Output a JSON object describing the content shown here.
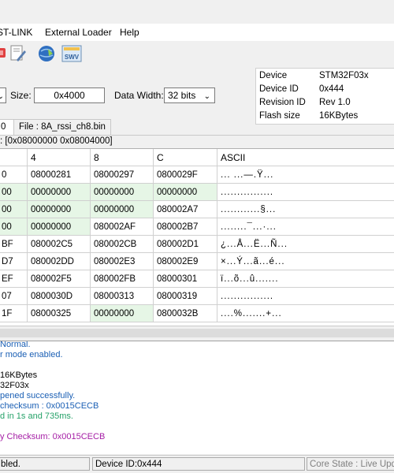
{
  "menu": {
    "items": [
      "ST-LINK",
      "External Loader",
      "Help"
    ],
    "partial_prefix": "ST-LINK"
  },
  "memory": {
    "size_label": "Size:",
    "size_value": "0x4000",
    "data_width_label": "Data Width:",
    "data_width_value": "32 bits"
  },
  "device_info": {
    "rows": [
      {
        "label": "Device",
        "value": "STM32F03x"
      },
      {
        "label": "Device ID",
        "value": "0x444"
      },
      {
        "label": "Revision ID",
        "value": "Rev 1.0"
      },
      {
        "label": "Flash size",
        "value": "16KBytes"
      }
    ]
  },
  "tabs": {
    "first": "0",
    "file": "File : 8A_rssi_ch8.bin"
  },
  "address_range": ": [0x08000000 0x08004000]",
  "table": {
    "headers": [
      "",
      "4",
      "8",
      "C",
      "ASCII"
    ],
    "rows": [
      {
        "addr": "0",
        "c4": "08000281",
        "c8": "08000297",
        "cC": "0800029F",
        "ascii": "... ...—.Ÿ...",
        "zero": false
      },
      {
        "addr": "00",
        "c4": "00000000",
        "c8": "00000000",
        "cC": "00000000",
        "ascii": "................",
        "zero": true
      },
      {
        "addr": "00",
        "c4": "00000000",
        "c8": "00000000",
        "cC": "080002A7",
        "ascii": "............§...",
        "zero": true
      },
      {
        "addr": "00",
        "c4": "00000000",
        "c8": "080002AF",
        "cC": "080002B7",
        "ascii": "........¯...·...",
        "zero": true
      },
      {
        "addr": "BF",
        "c4": "080002C5",
        "c8": "080002CB",
        "cC": "080002D1",
        "ascii": "¿...Å...Ë...Ñ...",
        "zero": false
      },
      {
        "addr": "D7",
        "c4": "080002DD",
        "c8": "080002E3",
        "cC": "080002E9",
        "ascii": "×...Ý...ã...é...",
        "zero": false
      },
      {
        "addr": "EF",
        "c4": "080002F5",
        "c8": "080002FB",
        "cC": "08000301",
        "ascii": "ï...õ...û.......",
        "zero": false
      },
      {
        "addr": "07",
        "c4": "0800030D",
        "c8": "08000313",
        "cC": "08000319",
        "ascii": "................",
        "zero": false
      },
      {
        "addr": "1F",
        "c4": "08000325",
        "c8": "00000000",
        "cC": "0800032B",
        "ascii": "....%.......+...",
        "zero": false
      }
    ]
  },
  "log": {
    "lines": [
      {
        "text": "Normal.",
        "color": "#1a5fb4"
      },
      {
        "text": "r mode enabled.",
        "color": "#1a5fb4"
      },
      {
        "text": "",
        "color": "#000000"
      },
      {
        "text": "16KBytes",
        "color": "#000000"
      },
      {
        "text": "32F03x",
        "color": "#000000"
      },
      {
        "text": "pened successfully.",
        "color": "#1a5fb4"
      },
      {
        "text": "checksum : 0x0015CECB",
        "color": "#1a5fb4"
      },
      {
        "text": "d in 1s and 735ms.",
        "color": "#26a269"
      },
      {
        "text": "",
        "color": "#000000"
      },
      {
        "text": "y Checksum: 0x0015CECB",
        "color": "#a51da5"
      }
    ]
  },
  "status": {
    "left": "bled.",
    "device": "Device ID:0x444",
    "core": "Core State : Live Upda"
  },
  "colors": {
    "zero_cell_bg": "#e6f6e6",
    "selected_row_bg": "#ffffff"
  },
  "icons": [
    "chip-icon",
    "wrench-icon",
    "globe-icon",
    "swv-icon"
  ]
}
